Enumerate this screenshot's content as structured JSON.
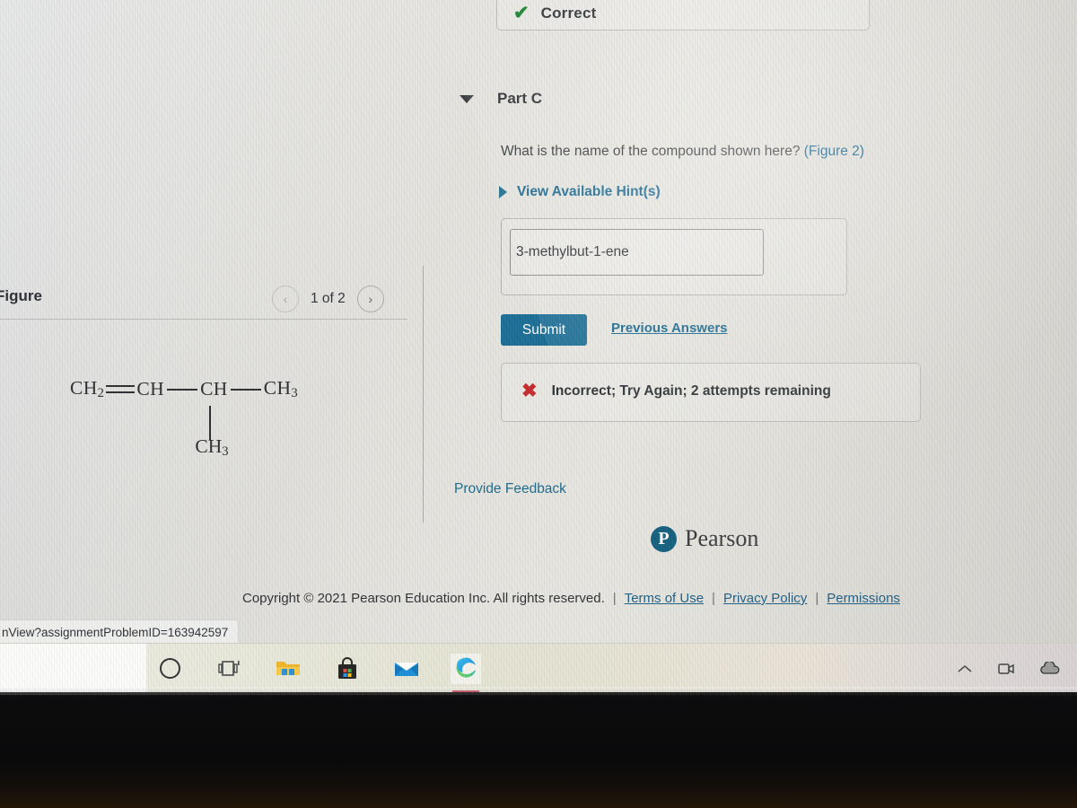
{
  "banner_correct": {
    "icon": "check-icon",
    "label": "Correct"
  },
  "part": {
    "caret": "caret-down-icon",
    "title": "Part C",
    "question_text": "What is the name of the compound shown here?",
    "question_figure_ref": "(Figure 2)",
    "hints_label": "View Available Hint(s)",
    "hints_caret": "caret-right-icon"
  },
  "answer": {
    "value": "3-methylbut-1-ene",
    "placeholder": ""
  },
  "actions": {
    "submit_label": "Submit",
    "previous_answers_label": "Previous Answers"
  },
  "banner_incorrect": {
    "icon": "x-icon",
    "label": "Incorrect; Try Again; 2 attempts remaining"
  },
  "feedback": {
    "label": "Provide Feedback"
  },
  "figure": {
    "title": "Figure",
    "prev_label": "‹",
    "next_label": "›",
    "counter": "1 of 2",
    "structure": {
      "main_chain": [
        {
          "label": "CH",
          "sub": "2"
        },
        {
          "bond": "double"
        },
        {
          "label": "CH",
          "sub": ""
        },
        {
          "bond": "single"
        },
        {
          "label": "CH",
          "sub": ""
        },
        {
          "bond": "single"
        },
        {
          "label": "CH",
          "sub": "3"
        }
      ],
      "branch_label": "CH",
      "branch_sub": "3",
      "formula_text": "CH2=CH-CH(CH3)-CH3"
    }
  },
  "brand": {
    "mark_letter": "P",
    "word": "Pearson"
  },
  "footer": {
    "copyright": "Copyright © 2021 Pearson Education Inc. All rights reserved.",
    "separator": "|",
    "links": [
      {
        "label": "Terms of Use"
      },
      {
        "label": "Privacy Policy"
      },
      {
        "label": "Permissions"
      }
    ]
  },
  "browser": {
    "status_url": "nView?assignmentProblemID=163942597"
  },
  "taskbar": {
    "icons": [
      {
        "name": "cortana-icon",
        "label": ""
      },
      {
        "name": "task-view-icon",
        "label": ""
      },
      {
        "name": "file-explorer-icon",
        "label": ""
      },
      {
        "name": "microsoft-store-icon",
        "label": ""
      },
      {
        "name": "mail-icon",
        "label": ""
      },
      {
        "name": "edge-browser-icon",
        "label": ""
      }
    ],
    "tray": [
      {
        "name": "show-hidden-icons-icon"
      },
      {
        "name": "camera-icon"
      },
      {
        "name": "weather-cloud-icon"
      }
    ]
  },
  "colors": {
    "accent_blue": "#14658d",
    "submit_blue": "#1a6d95",
    "correct_green": "#17812e",
    "incorrect_red": "#c52a2c",
    "pearson_teal": "#13607f"
  }
}
